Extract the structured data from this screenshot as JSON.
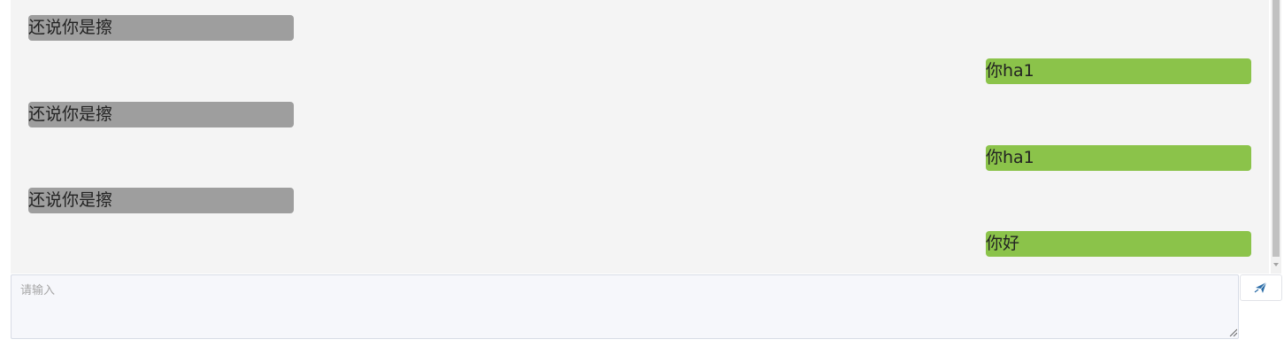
{
  "messages": [
    {
      "side": "other",
      "text": "还说你是擦"
    },
    {
      "side": "self",
      "text": "你ha1"
    },
    {
      "side": "other",
      "text": "还说你是擦"
    },
    {
      "side": "self",
      "text": "你ha1"
    },
    {
      "side": "other",
      "text": "还说你是擦"
    },
    {
      "side": "self",
      "text": "你好"
    }
  ],
  "composer": {
    "placeholder": "请输入",
    "value": ""
  },
  "send_button": {
    "icon": "paper-plane-icon"
  },
  "colors": {
    "chat_background": "#f4f4f4",
    "other_bubble": "#9e9e9e",
    "self_bubble": "#8bc34a",
    "send_icon": "#2d6ea8"
  }
}
